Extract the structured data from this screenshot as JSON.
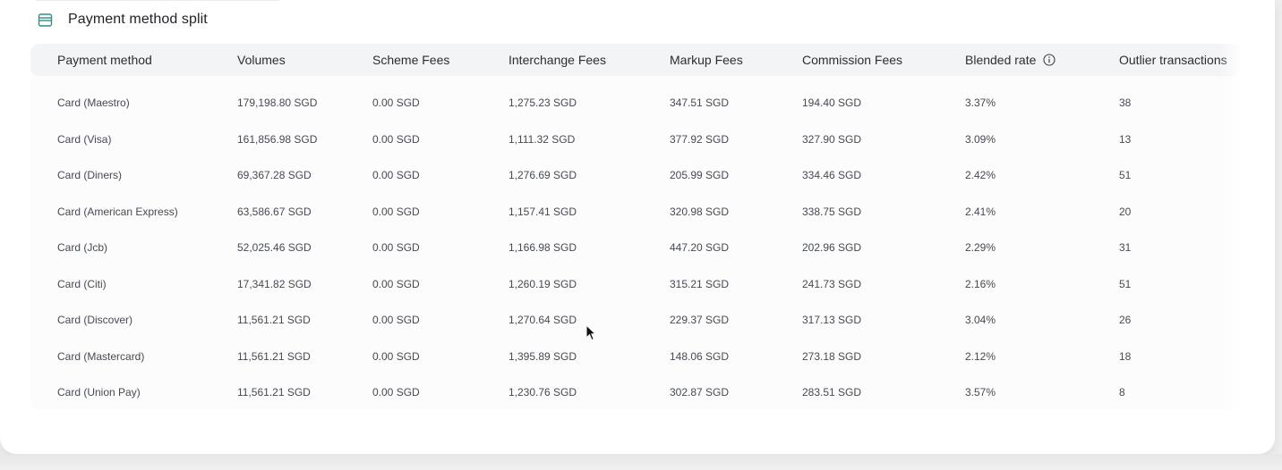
{
  "card": {
    "title": "Payment method split",
    "icon": "card-stack-icon"
  },
  "table": {
    "columns": [
      {
        "key": "method",
        "label": "Payment method"
      },
      {
        "key": "volumes",
        "label": "Volumes"
      },
      {
        "key": "scheme",
        "label": "Scheme Fees"
      },
      {
        "key": "interchange",
        "label": "Interchange Fees"
      },
      {
        "key": "markup",
        "label": "Markup Fees"
      },
      {
        "key": "commission",
        "label": "Commission Fees"
      },
      {
        "key": "blended",
        "label": "Blended rate",
        "icon": "info-icon"
      },
      {
        "key": "outliers",
        "label": "Outlier transactions"
      }
    ],
    "rows": [
      [
        "Card (Maestro)",
        "179,198.80 SGD",
        "0.00 SGD",
        "1,275.23 SGD",
        "347.51 SGD",
        "194.40 SGD",
        "3.37%",
        "38"
      ],
      [
        "Card (Visa)",
        "161,856.98 SGD",
        "0.00 SGD",
        "1,111.32 SGD",
        "377.92 SGD",
        "327.90 SGD",
        "3.09%",
        "13"
      ],
      [
        "Card (Diners)",
        "69,367.28 SGD",
        "0.00 SGD",
        "1,276.69 SGD",
        "205.99 SGD",
        "334.46 SGD",
        "2.42%",
        "51"
      ],
      [
        "Card (American Express)",
        "63,586.67 SGD",
        "0.00 SGD",
        "1,157.41 SGD",
        "320.98 SGD",
        "338.75 SGD",
        "2.41%",
        "20"
      ],
      [
        "Card (Jcb)",
        "52,025.46 SGD",
        "0.00 SGD",
        "1,166.98 SGD",
        "447.20 SGD",
        "202.96 SGD",
        "2.29%",
        "31"
      ],
      [
        "Card (Citi)",
        "17,341.82 SGD",
        "0.00 SGD",
        "1,260.19 SGD",
        "315.21 SGD",
        "241.73 SGD",
        "2.16%",
        "51"
      ],
      [
        "Card (Discover)",
        "11,561.21 SGD",
        "0.00 SGD",
        "1,270.64 SGD",
        "229.37 SGD",
        "317.13 SGD",
        "3.04%",
        "26"
      ],
      [
        "Card (Mastercard)",
        "11,561.21 SGD",
        "0.00 SGD",
        "1,395.89 SGD",
        "148.06 SGD",
        "273.18 SGD",
        "2.12%",
        "18"
      ],
      [
        "Card (Union Pay)",
        "11,561.21 SGD",
        "0.00 SGD",
        "1,230.76 SGD",
        "302.87 SGD",
        "283.51 SGD",
        "3.57%",
        "8"
      ]
    ]
  },
  "colors": {
    "accent_icon": "#2f8f84",
    "header_bg": "#f3f4f6"
  }
}
